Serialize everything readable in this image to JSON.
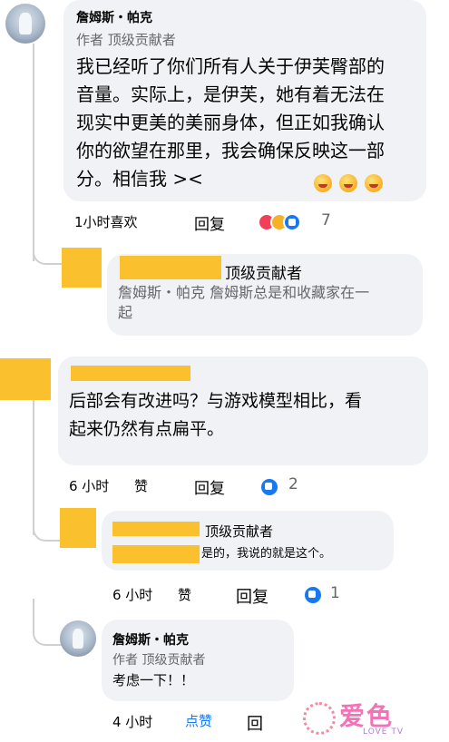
{
  "comment1": {
    "author": "詹姆斯・帕克",
    "badge": "作者 顶级贡献者",
    "text_lines": [
      "我已经听了你们所有人关于伊芙臀部的",
      "音量。实际上，是伊芙，她有着无法在",
      "现实中更美的美丽身体，但正如我确认",
      "你的欲望在那里，我会确保反映这一部",
      "分。相信我 ><"
    ],
    "time_like": "1小时喜欢",
    "reply": "回复",
    "reaction_count": "7"
  },
  "reply1": {
    "badge": "顶级贡献者",
    "text_lines": [
      "詹姆斯・帕克 詹姆斯总是和收藏家在一",
      "起"
    ]
  },
  "comment2": {
    "text_lines": [
      "后部会有改进吗？与游戏模型相比，看",
      "起来仍然有点扁平。"
    ],
    "time": "6 小时",
    "like": "赞",
    "reply": "回复",
    "reaction_count": "2"
  },
  "reply2": {
    "badge": "顶级贡献者",
    "text": "是的，我说的就是这个。",
    "time": "6 小时",
    "like": "赞",
    "reply": "回复",
    "reaction_count": "1"
  },
  "reply3": {
    "author": "詹姆斯・帕克",
    "badge": "作者 顶级贡献者",
    "text": "考虑一下！！",
    "time": "4 小时",
    "like": "点赞",
    "reply": "回"
  },
  "watermark": {
    "brand": "爱色",
    "sub": "LOVE TV"
  }
}
